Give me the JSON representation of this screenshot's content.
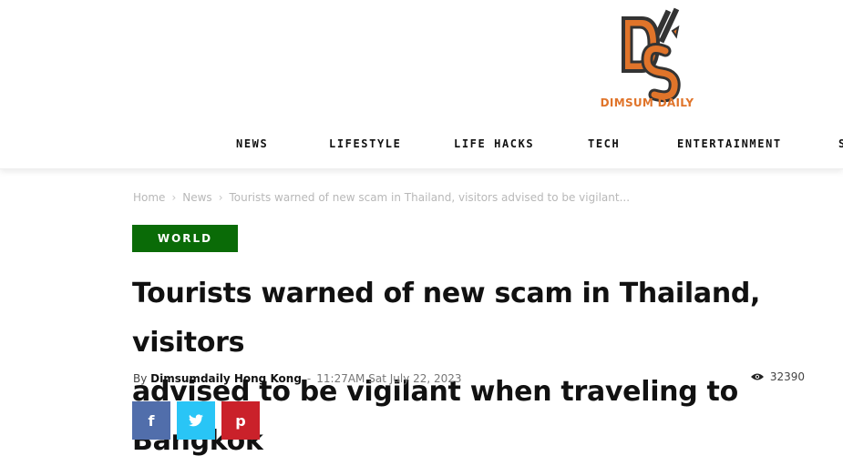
{
  "brand": {
    "name": "DIMSUM DAILY",
    "monogram": "DS"
  },
  "nav": {
    "items": [
      "NEWS",
      "LIFESTYLE",
      "LIFE HACKS",
      "TECH",
      "ENTERTAINMENT",
      "S"
    ]
  },
  "breadcrumb": {
    "home": "Home",
    "section": "News",
    "current": "Tourists warned of new scam in Thailand, visitors advised to be vigilant..."
  },
  "article": {
    "category": "WORLD",
    "title_line1": "Tourists warned of new scam in Thailand, visitors",
    "title_line2": "advised to be vigilant when traveling to Bangkok",
    "by": "By",
    "author": "Dimsumdaily Hong Kong",
    "dash": "-",
    "date": "11:27AM Sat July 22, 2023",
    "views": "32390"
  },
  "share": {
    "facebook": "f",
    "twitter": "t",
    "pinterest": "p"
  },
  "colors": {
    "category_bg": "#0a6b07",
    "facebook": "#516eab",
    "twitter": "#29c5f6",
    "pinterest": "#ca212a",
    "logo_orange": "#e0742a"
  }
}
